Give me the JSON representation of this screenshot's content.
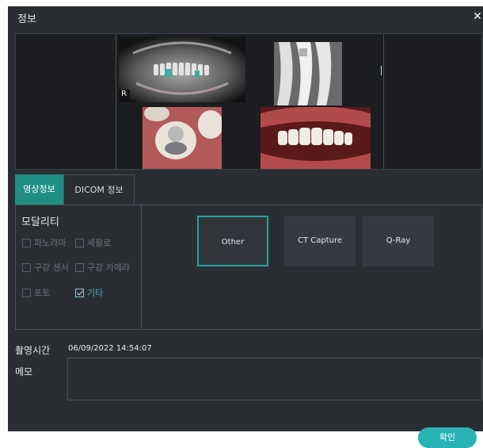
{
  "dialog": {
    "title": "정보"
  },
  "preview": {
    "images": [
      {
        "name": "panoramic x-ray",
        "marker": "R"
      },
      {
        "name": "periapical x-ray"
      },
      {
        "name": "intraoral photo crown"
      },
      {
        "name": "intraoral photo smile"
      }
    ]
  },
  "tabs": [
    {
      "label": "영상정보",
      "active": true
    },
    {
      "label": "DICOM 정보",
      "active": false
    }
  ],
  "modality": {
    "title": "모달리티",
    "checkboxes": [
      {
        "label": "파노라마",
        "checked": false
      },
      {
        "label": "세팔로",
        "checked": false
      },
      {
        "label": "구강 센서",
        "checked": false
      },
      {
        "label": "구강 카메라",
        "checked": false
      },
      {
        "label": "포토",
        "checked": false
      },
      {
        "label": "기타",
        "checked": true
      }
    ],
    "buttons": [
      {
        "label": "Other",
        "selected": true
      },
      {
        "label": "CT Capture",
        "selected": false
      },
      {
        "label": "Q-Ray",
        "selected": false
      }
    ]
  },
  "capture": {
    "label": "촬영시간",
    "value": "06/09/2022 14:54:07"
  },
  "memo": {
    "label": "메모",
    "value": ""
  },
  "ok_button": {
    "label": "확인"
  },
  "colors": {
    "accent": "#1f8f86",
    "button": "#28b3b7",
    "background": "#2a2e33"
  }
}
